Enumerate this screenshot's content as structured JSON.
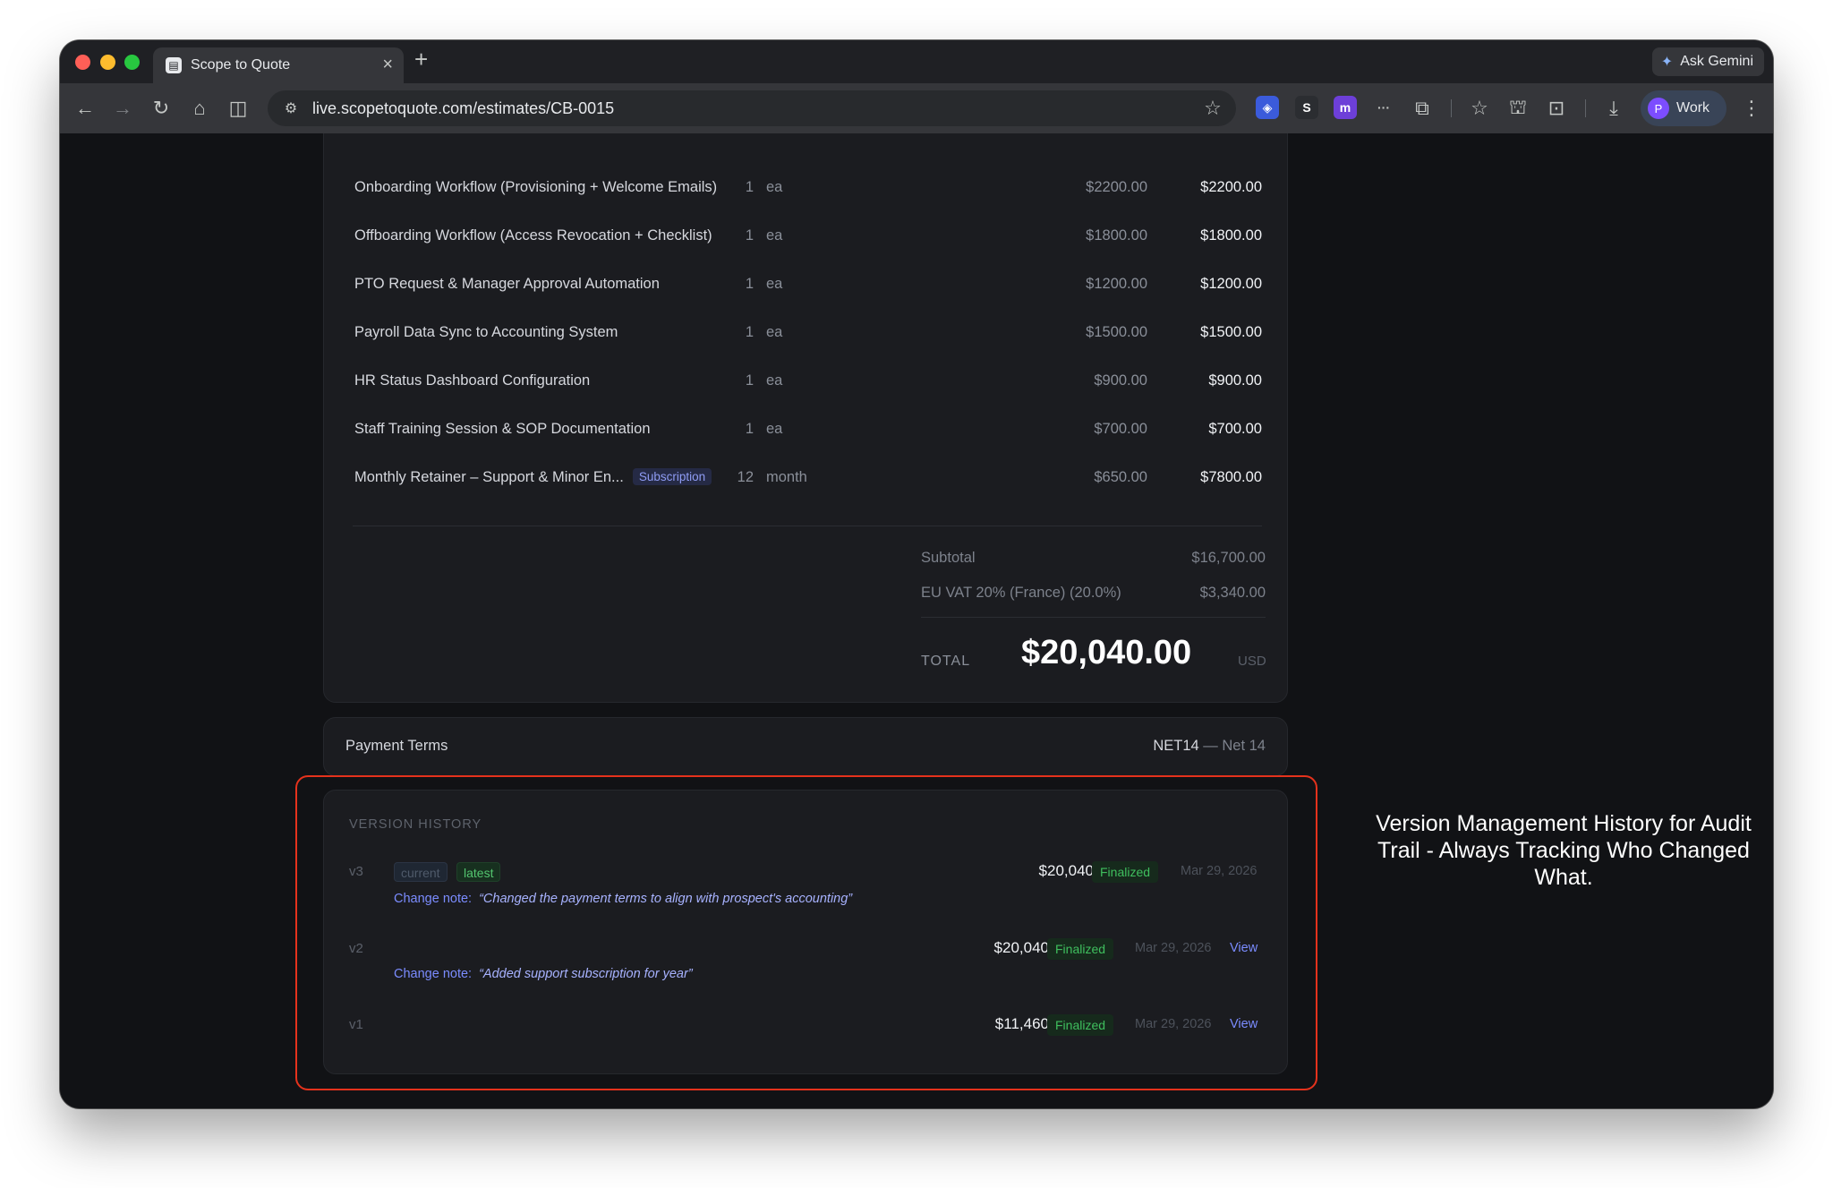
{
  "browser": {
    "tab_title": "Scope to Quote",
    "tab_close": "×",
    "new_tab": "+",
    "ask_gemini": "Ask Gemini",
    "url": "live.scopetoquote.com/estimates/CB-0015",
    "profile_initial": "P",
    "profile_name": "Work"
  },
  "line_items": [
    {
      "description": "Onboarding Workflow (Provisioning + Welcome Emails)",
      "qty": "1",
      "unit": "ea",
      "unit_price": "$2200.00",
      "amount": "$2200.00"
    },
    {
      "description": "Offboarding Workflow (Access Revocation + Checklist)",
      "qty": "1",
      "unit": "ea",
      "unit_price": "$1800.00",
      "amount": "$1800.00"
    },
    {
      "description": "PTO Request & Manager Approval Automation",
      "qty": "1",
      "unit": "ea",
      "unit_price": "$1200.00",
      "amount": "$1200.00"
    },
    {
      "description": "Payroll Data Sync to Accounting System",
      "qty": "1",
      "unit": "ea",
      "unit_price": "$1500.00",
      "amount": "$1500.00"
    },
    {
      "description": "HR Status Dashboard Configuration",
      "qty": "1",
      "unit": "ea",
      "unit_price": "$900.00",
      "amount": "$900.00"
    },
    {
      "description": "Staff Training Session & SOP Documentation",
      "qty": "1",
      "unit": "ea",
      "unit_price": "$700.00",
      "amount": "$700.00"
    },
    {
      "description": "Monthly Retainer – Support & Minor En...",
      "badge": "Subscription",
      "qty": "12",
      "unit": "month",
      "unit_price": "$650.00",
      "amount": "$7800.00"
    }
  ],
  "totals": {
    "subtotal_label": "Subtotal",
    "subtotal_value": "$16,700.00",
    "vat_label": "EU VAT 20% (France) (20.0%)",
    "vat_value": "$3,340.00",
    "total_label": "TOTAL",
    "total_value": "$20,040.00",
    "currency": "USD"
  },
  "payment_terms": {
    "label": "Payment Terms",
    "code": "NET14",
    "separator": "—",
    "description": "Net 14"
  },
  "version_history": {
    "title": "VERSION HISTORY",
    "change_note_label": "Change note:",
    "versions": [
      {
        "version": "v3",
        "tags": [
          "current",
          "latest"
        ],
        "amount": "$20,040",
        "status": "Finalized",
        "date": "Mar 29, 2026",
        "note": "“Changed the payment terms to align with prospect's accounting”"
      },
      {
        "version": "v2",
        "amount": "$20,040",
        "status": "Finalized",
        "date": "Mar 29, 2026",
        "action": "View",
        "note": "“Added support subscription for year”"
      },
      {
        "version": "v1",
        "amount": "$11,460",
        "status": "Finalized",
        "date": "Mar 29, 2026",
        "action": "View"
      }
    ]
  },
  "caption": "Version Management History for Audit Trail - Always Tracking Who Changed What.",
  "colors": {
    "page_bg": "#111215",
    "card_bg": "#1b1c20",
    "highlight_border": "#e5321c",
    "status_green": "#3fbf5e",
    "link_blue": "#7b8cff"
  },
  "icons": [
    "back-arrow-icon",
    "forward-arrow-icon",
    "reload-icon",
    "home-icon",
    "split-view-icon",
    "site-settings-icon",
    "bookmark-star-icon",
    "extensions-icon",
    "download-icon",
    "more-vert-icon"
  ]
}
